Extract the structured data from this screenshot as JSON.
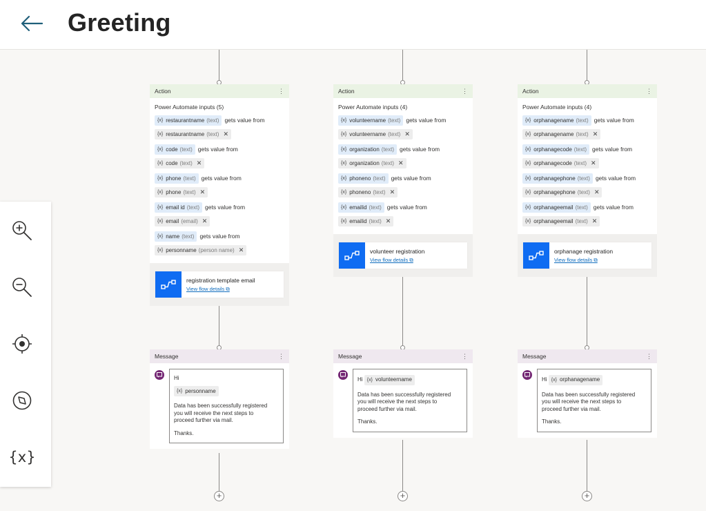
{
  "header": {
    "title": "Greeting",
    "back_label": "Back"
  },
  "zoombar": {
    "var_glyph": "{x}"
  },
  "common": {
    "action_label": "Action",
    "message_label": "Message",
    "gets": "gets value from",
    "view_flow": "View flow details",
    "var_mark": "{x}",
    "kebab": "⋮",
    "remove": "✕",
    "plus": "+"
  },
  "col1": {
    "inputs_title": "Power Automate inputs (5)",
    "inputs": [
      {
        "name": "restaurantname",
        "type": "(text)",
        "src": "restaurantname",
        "src_type": "(text)"
      },
      {
        "name": "code",
        "type": "(text)",
        "src": "code",
        "src_type": "(text)"
      },
      {
        "name": "phone",
        "type": "(text)",
        "src": "phone",
        "src_type": "(text)"
      },
      {
        "name": "email id",
        "type": "(text)",
        "src": "email",
        "src_type": "(email)"
      },
      {
        "name": "name",
        "type": "(text)",
        "src": "personname",
        "src_type": "(person name)"
      }
    ],
    "flow_name": "registration template email",
    "msg_hi": "Hi",
    "msg_var": "personname",
    "msg_lines": [
      "Data has been successfully registered",
      "you will receive the next steps to",
      "proceed further via mail."
    ],
    "msg_thanks": "Thanks."
  },
  "col2": {
    "inputs_title": "Power Automate inputs (4)",
    "inputs": [
      {
        "name": "volunteername",
        "type": "(text)",
        "src": "volunteername",
        "src_type": "(text)"
      },
      {
        "name": "organization",
        "type": "(text)",
        "src": "organization",
        "src_type": "(text)"
      },
      {
        "name": "phoneno",
        "type": "(text)",
        "src": "phoneno",
        "src_type": "(text)"
      },
      {
        "name": "emailid",
        "type": "(text)",
        "src": "emailid",
        "src_type": "(text)"
      }
    ],
    "flow_name": "volunteer registration",
    "msg_hi": "Hi",
    "msg_var": "volunteername",
    "msg_lines": [
      "Data has been successfully registered",
      "you will receive the next steps to",
      "proceed further via mail."
    ],
    "msg_thanks": "Thanks."
  },
  "col3": {
    "inputs_title": "Power Automate inputs (4)",
    "inputs": [
      {
        "name": "orphanagename",
        "type": "(text)",
        "src": "orphanagename",
        "src_type": "(text)"
      },
      {
        "name": "orphanagecode",
        "type": "(text)",
        "src": "orphanagecode",
        "src_type": "(text)"
      },
      {
        "name": "orphanagephone",
        "type": "(text)",
        "src": "orphanagephone",
        "src_type": "(text)"
      },
      {
        "name": "orphanageemail",
        "type": "(text)",
        "src": "orphanageemail",
        "src_type": "(text)"
      }
    ],
    "flow_name": "orphanage registration",
    "msg_hi": "Hi",
    "msg_var": "orphanagename",
    "msg_lines": [
      "Data has been successfully registered",
      "you will receive the next steps to",
      "proceed further via mail."
    ],
    "msg_thanks": "Thanks."
  },
  "colors": {
    "accent": "#0f6cf2",
    "action_header": "#eaf3e4",
    "message_header": "#efe8ef",
    "message_icon": "#742774",
    "link": "#0f6cbd"
  }
}
